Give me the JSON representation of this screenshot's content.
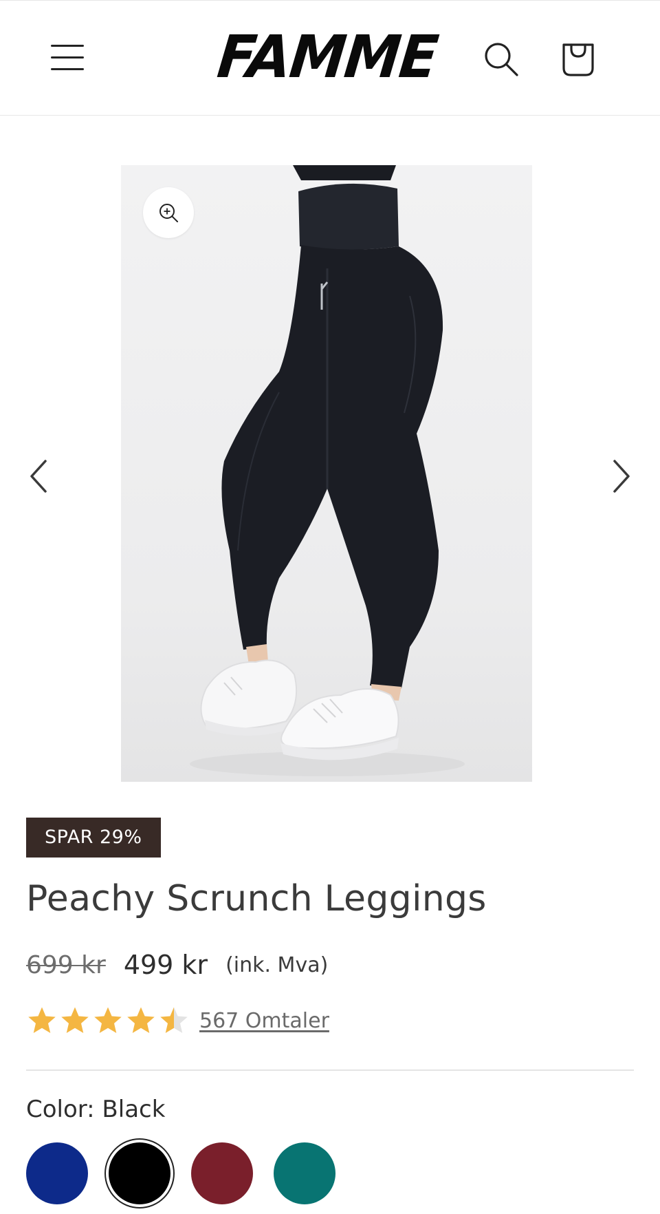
{
  "header": {
    "brand": "FAMME",
    "menu_icon": "hamburger-menu-icon",
    "search_icon": "search-icon",
    "cart_icon": "shopping-bag-icon"
  },
  "gallery": {
    "image_alt": "Peachy Scrunch Leggings",
    "zoom_icon": "zoom-in-icon",
    "prev_icon": "chevron-left-icon",
    "next_icon": "chevron-right-icon"
  },
  "product": {
    "badge": "SPAR 29%",
    "title": "Peachy Scrunch Leggings",
    "price_old": "699 kr",
    "price_new": "499 kr",
    "price_note": "(ink. Mva)",
    "rating": 4.5,
    "rating_max": 5,
    "reviews_label": "567 Omtaler",
    "color_label": "Color: Black",
    "colors": [
      {
        "name": "Blue",
        "hex": "#0d2a8a",
        "selected": false
      },
      {
        "name": "Black",
        "hex": "#000000",
        "selected": true
      },
      {
        "name": "Burgundy",
        "hex": "#7a1f2b",
        "selected": false
      },
      {
        "name": "Teal",
        "hex": "#087472",
        "selected": false
      }
    ]
  },
  "colors": {
    "badge_bg": "#382a26",
    "star": "#f4b642",
    "star_empty": "#e3e3e3"
  }
}
